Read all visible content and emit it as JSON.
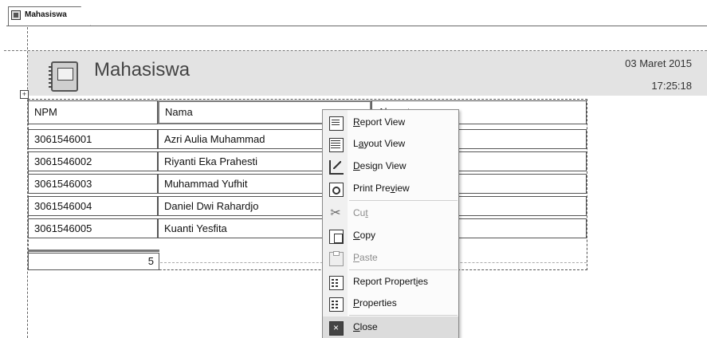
{
  "tab": {
    "label": "Mahasiswa"
  },
  "report": {
    "title": "Mahasiswa",
    "date": "03 Maret 2015",
    "time": "17:25:18"
  },
  "table": {
    "columns": [
      "NPM",
      "Nama",
      "Alamat"
    ],
    "rows": [
      {
        "npm": "3061546001",
        "nama": "Azri Aulia Muhammad"
      },
      {
        "npm": "3061546002",
        "nama": "Riyanti Eka Prahesti"
      },
      {
        "npm": "3061546003",
        "nama": "Muhammad Yufhit"
      },
      {
        "npm": "3061546004",
        "nama": "Daniel Dwi Rahardjo"
      },
      {
        "npm": "3061546005",
        "nama": "Kuanti Yesfita"
      }
    ],
    "count": "5"
  },
  "context_menu": {
    "items": [
      {
        "label": "Report View",
        "icon": "report-view-icon",
        "enabled": true
      },
      {
        "label": "Layout View",
        "icon": "layout-view-icon",
        "enabled": true
      },
      {
        "label": "Design View",
        "icon": "design-view-icon",
        "enabled": true
      },
      {
        "label": "Print Preview",
        "icon": "print-preview-icon",
        "enabled": true
      },
      {
        "label": "Cut",
        "icon": "scissors-icon",
        "enabled": false
      },
      {
        "label": "Copy",
        "icon": "copy-icon",
        "enabled": true
      },
      {
        "label": "Paste",
        "icon": "paste-icon",
        "enabled": false
      },
      {
        "label": "Report Properties",
        "icon": "report-properties-icon",
        "enabled": true
      },
      {
        "label": "Properties",
        "icon": "properties-icon",
        "enabled": true
      },
      {
        "label": "Close",
        "icon": "close-icon",
        "enabled": true,
        "highlighted": true
      }
    ]
  },
  "colors": {
    "header_band": "#e3e3e3",
    "menu_hover": "#dcdcdc",
    "disabled_text": "#8c8c8c"
  }
}
